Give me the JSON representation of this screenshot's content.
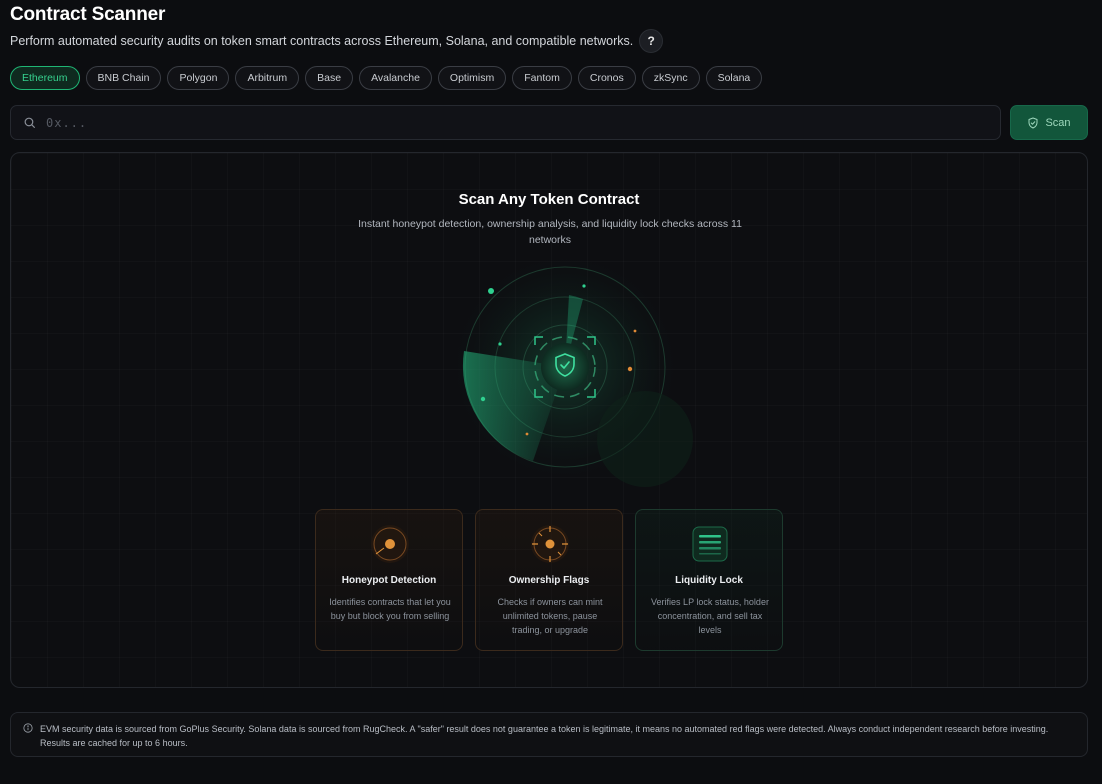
{
  "header": {
    "title": "Contract Scanner",
    "subtitle": "Perform automated security audits on token smart contracts across Ethereum, Solana, and compatible networks.",
    "help_label": "?"
  },
  "networks": [
    {
      "label": "Ethereum",
      "active": true
    },
    {
      "label": "BNB Chain",
      "active": false
    },
    {
      "label": "Polygon",
      "active": false
    },
    {
      "label": "Arbitrum",
      "active": false
    },
    {
      "label": "Base",
      "active": false
    },
    {
      "label": "Avalanche",
      "active": false
    },
    {
      "label": "Optimism",
      "active": false
    },
    {
      "label": "Fantom",
      "active": false
    },
    {
      "label": "Cronos",
      "active": false
    },
    {
      "label": "zkSync",
      "active": false
    },
    {
      "label": "Solana",
      "active": false
    }
  ],
  "search": {
    "placeholder": "0x...",
    "value": "",
    "scan_label": "Scan"
  },
  "hero": {
    "title": "Scan Any Token Contract",
    "subtitle": "Instant honeypot detection, ownership analysis, and liquidity lock checks across 11 networks"
  },
  "features": [
    {
      "title": "Honeypot Detection",
      "description": "Identifies contracts that let you buy but block you from selling",
      "icon": "honeypot-target-icon",
      "accent": "#e0923a"
    },
    {
      "title": "Ownership Flags",
      "description": "Checks if owners can mint unlimited tokens, pause trading, or upgrade",
      "icon": "ownership-crosshair-icon",
      "accent": "#e0923a"
    },
    {
      "title": "Liquidity Lock",
      "description": "Verifies LP lock status, holder concentration, and sell tax levels",
      "icon": "liquidity-lock-icon",
      "accent": "#2fc48a"
    }
  ],
  "footer": {
    "text": "EVM security data is sourced from GoPlus Security. Solana data is sourced from RugCheck. A \"safer\" result does not guarantee a token is legitimate, it means no automated red flags were detected. Always conduct independent research before investing. Results are cached for up to 6 hours."
  },
  "colors": {
    "accent_green": "#1fb574",
    "accent_orange": "#e0923a",
    "background": "#0c0d10"
  }
}
